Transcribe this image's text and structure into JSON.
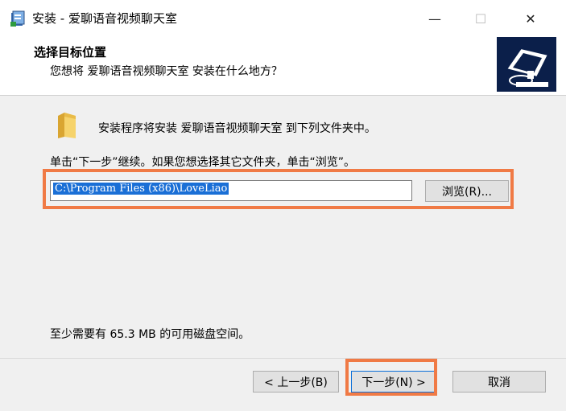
{
  "window": {
    "title": "安装 - 爱聊语音视频聊天室",
    "controls": {
      "minimize": "—",
      "maximize": "☐",
      "close": "✕"
    }
  },
  "header": {
    "title": "选择目标位置",
    "subtitle": "您想将 爱聊语音视频聊天室 安装在什么地方？"
  },
  "body": {
    "intro": "安装程序将安装 爱聊语音视频聊天室 到下列文件夹中。",
    "instruction": "单击“下一步”继续。如果您想选择其它文件夹，单击“浏览”。",
    "install_path": "C:\\Program Files (x86)\\LoveLiao",
    "browse_label": "浏览(R)...",
    "space_required": "至少需要有 65.3 MB 的可用磁盘空间。"
  },
  "footer": {
    "back_label": "< 上一步(B)",
    "next_label": "下一步(N) >",
    "cancel_label": "取消"
  },
  "colors": {
    "highlight": "#f07a45",
    "selection": "#1a6fd6",
    "default_button_border": "#0a6fd8"
  }
}
